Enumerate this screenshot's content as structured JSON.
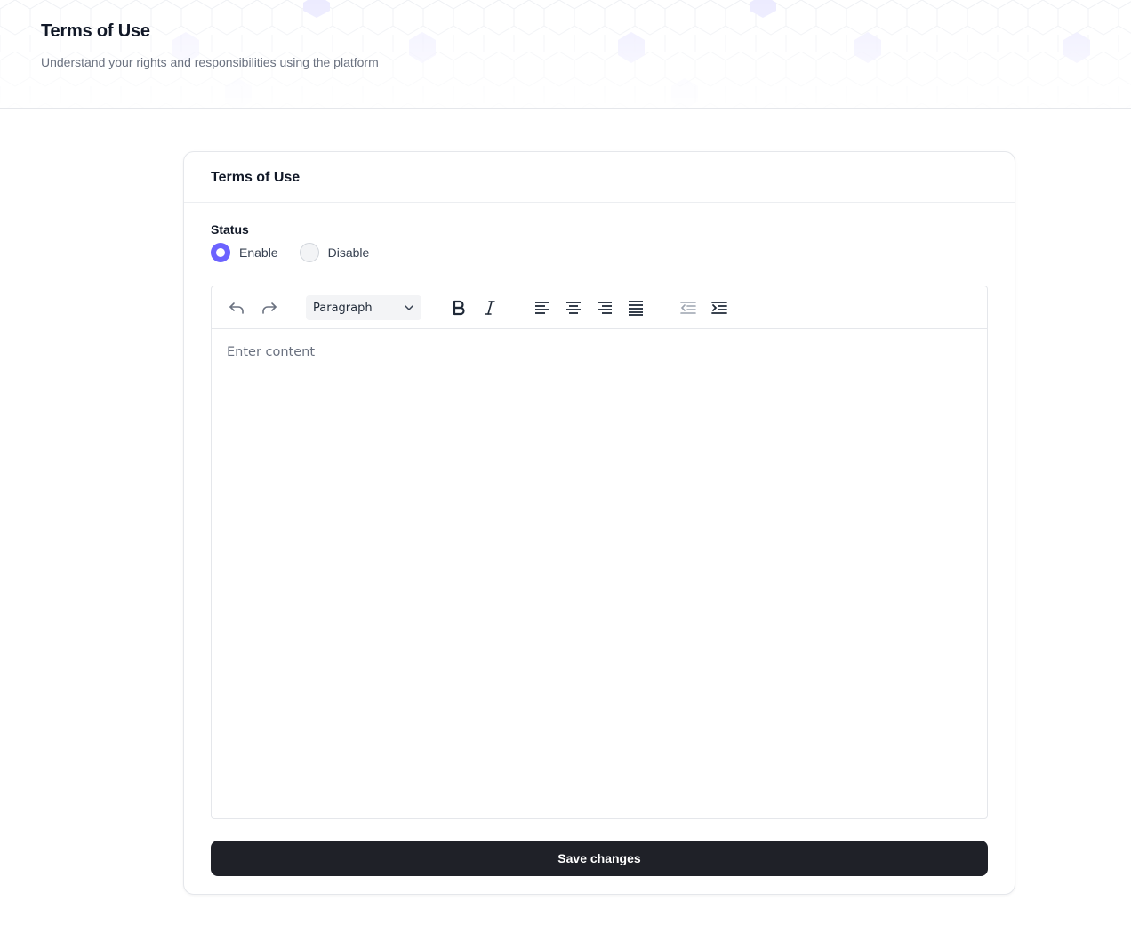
{
  "header": {
    "title": "Terms of Use",
    "subtitle": "Understand your rights and responsibilities using the platform"
  },
  "card": {
    "title": "Terms of Use",
    "status_label": "Status",
    "status_options": [
      {
        "label": "Enable",
        "selected": true
      },
      {
        "label": "Disable",
        "selected": false
      }
    ]
  },
  "editor": {
    "toolbar": {
      "undo_icon": "undo-icon",
      "redo_icon": "redo-icon",
      "block_format": "Paragraph",
      "bold_icon": "bold-icon",
      "italic_icon": "italic-icon",
      "align_left_icon": "align-left-icon",
      "align_center_icon": "align-center-icon",
      "align_right_icon": "align-right-icon",
      "align_justify_icon": "align-justify-icon",
      "outdent_icon": "outdent-icon",
      "indent_icon": "indent-icon"
    },
    "placeholder": "Enter content"
  },
  "save_label": "Save changes",
  "colors": {
    "accent": "#6c63ff",
    "button_bg": "#1f2128",
    "hexagon_tint": "#ecebff"
  }
}
